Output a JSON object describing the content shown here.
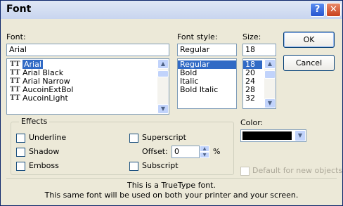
{
  "window": {
    "title": "Font",
    "help_label": "?",
    "close_label": "✕"
  },
  "font": {
    "label": "Font:",
    "value": "Arial",
    "items": [
      "Arial",
      "Arial Black",
      "Arial Narrow",
      "AucoinExtBol",
      "AucoinLight"
    ],
    "selected": "Arial",
    "icon": "truetype-icon",
    "icon_glyph": "T"
  },
  "style": {
    "label": "Font style:",
    "value": "Regular",
    "items": [
      "Regular",
      "Bold",
      "Italic",
      "Bold Italic"
    ],
    "selected": "Regular"
  },
  "size": {
    "label": "Size:",
    "value": "18",
    "items": [
      "18",
      "20",
      "24",
      "28",
      "32"
    ],
    "selected": "18"
  },
  "buttons": {
    "ok": "OK",
    "cancel": "Cancel"
  },
  "effects": {
    "label": "Effects",
    "underline": "Underline",
    "shadow": "Shadow",
    "emboss": "Emboss",
    "superscript": "Superscript",
    "subscript": "Subscript",
    "offset_label": "Offset:",
    "offset_value": "0",
    "offset_unit": "%"
  },
  "color": {
    "label": "Color:",
    "value_hex": "#000000",
    "default_label": "Default for new objects"
  },
  "info": {
    "line1": "This is a TrueType font.",
    "line2": "This same font will be used on both your printer and your screen."
  }
}
